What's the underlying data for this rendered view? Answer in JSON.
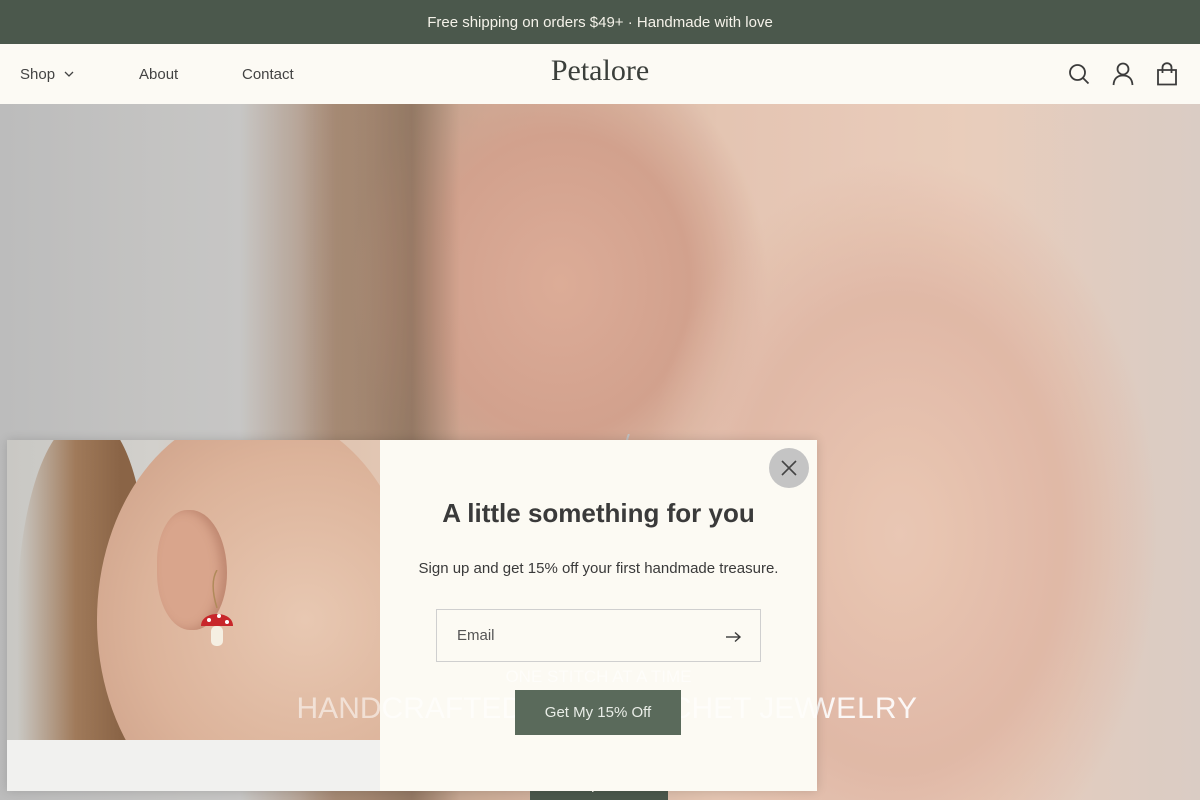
{
  "announcement": "Free shipping on orders $49+ · Handmade with love",
  "header": {
    "logo": "Petalore",
    "nav": [
      {
        "label": "Shop"
      },
      {
        "label": "About"
      },
      {
        "label": "Contact"
      }
    ],
    "icons": [
      "search-icon",
      "account-icon",
      "cart-icon"
    ]
  },
  "hero": {
    "eyebrow": "ONE STITCH AT A TIME",
    "title": "HANDCRAFTED MINI CROCHET JEWELRY",
    "cta": "Shop Now"
  },
  "modal": {
    "heading": "A little something for you",
    "subtext": "Sign up and get 15% off your first handmade treasure.",
    "email_placeholder": "Email",
    "button": "Get My 15% Off"
  },
  "colors": {
    "announcement_bg": "#3c4a3d",
    "header_bg": "#fcfaf3",
    "modal_button": "#5a6a5b",
    "close_button": "#c4c4c4"
  }
}
